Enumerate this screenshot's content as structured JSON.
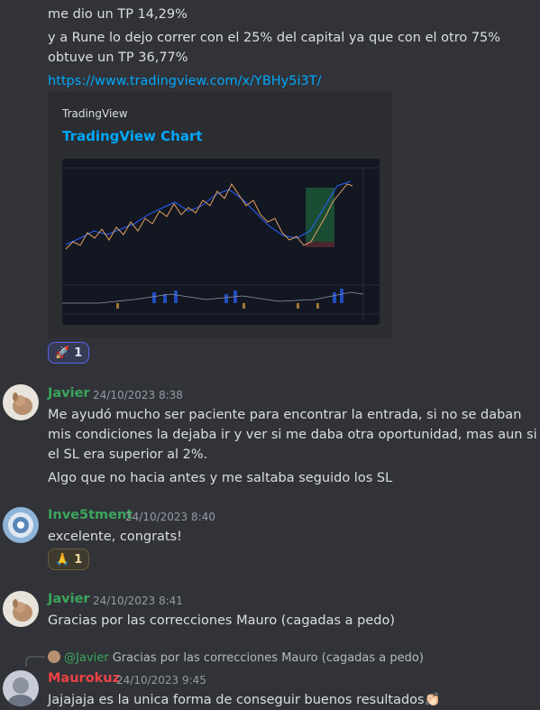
{
  "top_message": {
    "line1": "me dio un TP 14,29%",
    "line2": "y a Rune lo dejo correr con el 25% del capital ya que con el otro 75%",
    "line3": "obtuve un TP 36,77%",
    "link": "https://www.tradingview.com/x/YBHy5i3T/"
  },
  "embed": {
    "provider": "TradingView",
    "title": "TradingView Chart"
  },
  "reactions": {
    "rocket": {
      "emoji": "🚀",
      "count": "1"
    },
    "pray": {
      "emoji": "🙏",
      "count": "1"
    }
  },
  "messages": [
    {
      "author": "Javier",
      "author_color": "#3ba55c",
      "timestamp": "24/10/2023 8:38",
      "lines": [
        "Me ayudó mucho ser paciente para encontrar la entrada, si no se daban",
        "mis condiciones la dejaba ir y ver si me daba otra oportunidad, mas aun si",
        "el SL era superior al 2%."
      ],
      "extra": "Algo que no hacia antes y me saltaba seguido los SL"
    },
    {
      "author": "Inve5tment",
      "author_color": "#3ba55c",
      "timestamp": "24/10/2023 8:40",
      "text": "excelente, congrats!"
    },
    {
      "author": "Javier",
      "author_color": "#3ba55c",
      "timestamp": "24/10/2023 8:41",
      "text": "Gracias por las correcciones Mauro (cagadas a pedo)"
    },
    {
      "reply_to": "@Javier",
      "reply_text": "Gracias por las correcciones Mauro (cagadas a pedo)",
      "author": "Maurokuz",
      "author_color": "#ed4245",
      "timestamp": "24/10/2023 9:45",
      "text": "Jajajaja es la unica forma de conseguir buenos resultados",
      "emoji": "👏🏻"
    }
  ]
}
